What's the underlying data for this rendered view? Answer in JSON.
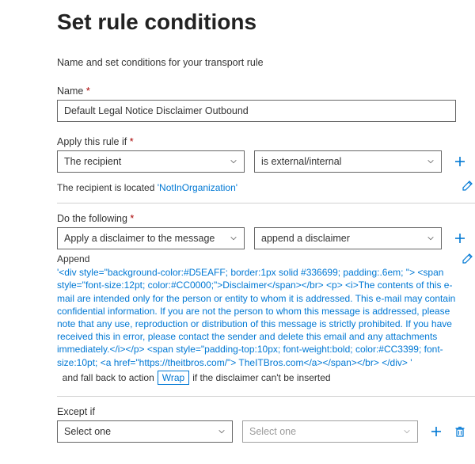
{
  "header": {
    "title": "Set rule conditions",
    "intro": "Name and set conditions for your transport rule"
  },
  "name": {
    "label": "Name",
    "value": "Default Legal Notice Disclaimer Outbound"
  },
  "condition": {
    "label": "Apply this rule if",
    "left": "The recipient",
    "right": "is external/internal",
    "helper_prefix": "The recipient is located ",
    "helper_value": "'NotInOrganization'"
  },
  "action": {
    "label": "Do the following",
    "left": "Apply a disclaimer to the message",
    "right": "append a disclaimer",
    "append_label": "Append",
    "append_text": "'<div style=\"background-color:#D5EAFF; border:1px solid #336699; padding:.6em; \"> <span style=\"font-size:12pt; color:#CC0000;\">Disclaimer</span></br> <p> <i>The contents of this e-mail are intended only for the person or entity to whom it is addressed. This e-mail may contain confidential information. If you are not the person to whom this message is addressed, please note that any use, reproduction or distribution of this message is strictly prohibited. If you have received this in error, please contact the sender and delete this email and any attachments immediately.</i></p> <span style=\"padding-top:10px; font-weight:bold; color:#CC3399; font-size:10pt; <a href=\"https://theitbros.com/\"> TheITBros.com</a></span></br> </div> '",
    "fallback_prefix": "  and fall back to action",
    "fallback_value": "Wrap",
    "fallback_suffix": "if the disclaimer can't be inserted"
  },
  "except": {
    "label": "Except if",
    "left": "Select one",
    "right": "Select one"
  }
}
